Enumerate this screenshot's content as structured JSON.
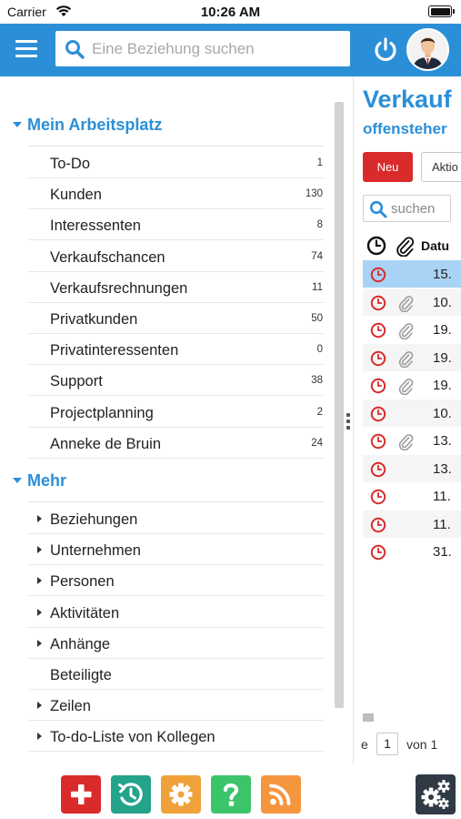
{
  "status_bar": {
    "carrier": "Carrier",
    "time": "10:26 AM"
  },
  "header": {
    "search_placeholder": "Eine Beziehung suchen"
  },
  "sidebar": {
    "workspace_title": "Mein Arbeitsplatz",
    "workspace_items": [
      {
        "label": "To-Do",
        "count": "1"
      },
      {
        "label": "Kunden",
        "count": "130"
      },
      {
        "label": "Interessenten",
        "count": "8"
      },
      {
        "label": "Verkaufschancen",
        "count": "74"
      },
      {
        "label": "Verkaufsrechnungen",
        "count": "11"
      },
      {
        "label": "Privatkunden",
        "count": "50"
      },
      {
        "label": "Privatinteressenten",
        "count": "0"
      },
      {
        "label": "Support",
        "count": "38"
      },
      {
        "label": "Projectplanning",
        "count": "2"
      },
      {
        "label": "Anneke de Bruin",
        "count": "24"
      }
    ],
    "more_title": "Mehr",
    "more_items": [
      {
        "label": "Beziehungen",
        "expandable": true
      },
      {
        "label": "Unternehmen",
        "expandable": true
      },
      {
        "label": "Personen",
        "expandable": true
      },
      {
        "label": "Aktivitäten",
        "expandable": true
      },
      {
        "label": "Anhänge",
        "expandable": true
      },
      {
        "label": "Beteiligte",
        "expandable": false
      },
      {
        "label": "Zeilen",
        "expandable": true
      },
      {
        "label": "To-do-Liste von Kollegen",
        "expandable": true
      }
    ]
  },
  "panel": {
    "title": "Verkauf",
    "subtitle": "offensteher",
    "new_button": "Neu",
    "action_button": "Aktio",
    "search_placeholder": "suchen",
    "date_column": "Datu",
    "rows": [
      {
        "date": "15.",
        "attachment": false,
        "selected": true
      },
      {
        "date": "10.",
        "attachment": true,
        "selected": false
      },
      {
        "date": "19.",
        "attachment": true,
        "selected": false
      },
      {
        "date": "19.",
        "attachment": true,
        "selected": false
      },
      {
        "date": "19.",
        "attachment": true,
        "selected": false
      },
      {
        "date": "10.",
        "attachment": false,
        "selected": false
      },
      {
        "date": "13.",
        "attachment": true,
        "selected": false
      },
      {
        "date": "13.",
        "attachment": false,
        "selected": false
      },
      {
        "date": "11.",
        "attachment": false,
        "selected": false
      },
      {
        "date": "11.",
        "attachment": false,
        "selected": false
      },
      {
        "date": "31.",
        "attachment": false,
        "selected": false
      }
    ],
    "pager": {
      "prefix": "e",
      "page": "1",
      "of_label": "von 1"
    }
  },
  "toolbar": {
    "icons": [
      "add-icon",
      "history-icon",
      "settings-icon",
      "help-icon",
      "rss-icon",
      "cogs-icon"
    ]
  },
  "colors": {
    "brand_blue": "#2b8fd8",
    "red": "#d92b2b",
    "teal": "#23a38a",
    "orange": "#f0a23a",
    "green": "#3cc46b",
    "rss_orange": "#f5963f",
    "dark": "#2f3a45",
    "selection": "#a9d3f4"
  }
}
